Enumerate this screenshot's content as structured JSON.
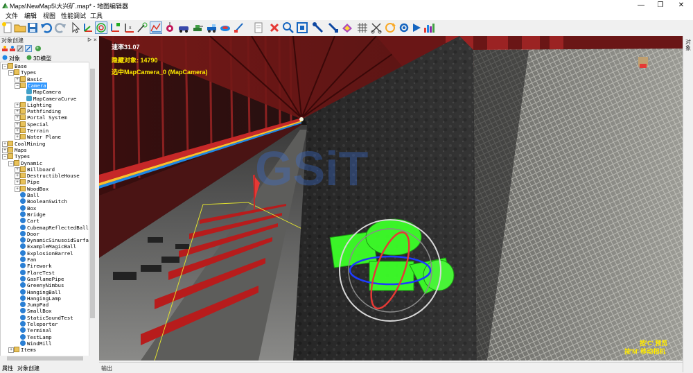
{
  "window": {
    "title": "Maps\\NewMap5\\大兴矿.map* - 地图编辑器",
    "controls": {
      "minimize": "—",
      "maximize": "❐",
      "close": "✕"
    }
  },
  "menu": {
    "items": [
      "文件",
      "编辑",
      "视图",
      "性能调试",
      "工具"
    ]
  },
  "toolbar": {
    "icons": [
      "new-file-icon",
      "open-folder-icon",
      "save-icon",
      "undo-icon",
      "redo-icon",
      "select-arrow-icon",
      "move-axis-icon",
      "rotate-icon",
      "scale-axis-icon",
      "axis-x-icon",
      "snap-icon",
      "terrain-icon",
      "place-object-icon",
      "car-icon",
      "tank-icon",
      "vehicle-icon",
      "water-icon",
      "sky-icon",
      "document-icon",
      "delete-icon",
      "zoom-icon",
      "frame-icon",
      "probe-icon",
      "measure-icon",
      "paint-icon",
      "grid-icon",
      "cut-icon",
      "refresh-icon",
      "settings-icon",
      "play-icon",
      "stats-icon"
    ]
  },
  "left_panel": {
    "title": "对象创建",
    "pin": "ᐅ",
    "close": "×",
    "tabs": {
      "objects": "对象",
      "model3d": "3D模型"
    },
    "tree": [
      {
        "label": "Base",
        "depth": 0,
        "type": "folder",
        "exp": "−"
      },
      {
        "label": "Types",
        "depth": 1,
        "type": "folder",
        "exp": "−"
      },
      {
        "label": "Basic",
        "depth": 2,
        "type": "folder",
        "exp": "+"
      },
      {
        "label": "Camera",
        "depth": 2,
        "type": "folder",
        "exp": "−",
        "selected": true
      },
      {
        "label": "MapCamera",
        "depth": 3,
        "type": "cam"
      },
      {
        "label": "MapCameraCurve",
        "depth": 3,
        "type": "cam"
      },
      {
        "label": "Lighting",
        "depth": 2,
        "type": "folder",
        "exp": "+"
      },
      {
        "label": "Pathfinding",
        "depth": 2,
        "type": "folder",
        "exp": "+"
      },
      {
        "label": "Portal System",
        "depth": 2,
        "type": "folder",
        "exp": "+"
      },
      {
        "label": "Special",
        "depth": 2,
        "type": "folder",
        "exp": "+"
      },
      {
        "label": "Terrain",
        "depth": 2,
        "type": "folder",
        "exp": "+"
      },
      {
        "label": "Water Plane",
        "depth": 2,
        "type": "folder",
        "exp": "+"
      },
      {
        "label": "CoalMining",
        "depth": 0,
        "type": "folder",
        "exp": "+"
      },
      {
        "label": "Maps",
        "depth": 0,
        "type": "folder",
        "exp": "+"
      },
      {
        "label": "Types",
        "depth": 0,
        "type": "folder",
        "exp": "−"
      },
      {
        "label": "Dynamic",
        "depth": 1,
        "type": "folder",
        "exp": "−"
      },
      {
        "label": "Billboard",
        "depth": 2,
        "type": "folder",
        "exp": "+"
      },
      {
        "label": "DestructibleHouse",
        "depth": 2,
        "type": "folder",
        "exp": "+"
      },
      {
        "label": "Pipe",
        "depth": 2,
        "type": "folder",
        "exp": "+"
      },
      {
        "label": "WoodBox",
        "depth": 2,
        "type": "folder",
        "exp": "+"
      },
      {
        "label": "Ball",
        "depth": 2,
        "type": "ball"
      },
      {
        "label": "BooleanSwitch",
        "depth": 2,
        "type": "ball"
      },
      {
        "label": "Box",
        "depth": 2,
        "type": "ball"
      },
      {
        "label": "Bridge",
        "depth": 2,
        "type": "ball"
      },
      {
        "label": "Cart",
        "depth": 2,
        "type": "ball"
      },
      {
        "label": "CubemapReflectedBall",
        "depth": 2,
        "type": "ball"
      },
      {
        "label": "Door",
        "depth": 2,
        "type": "ball"
      },
      {
        "label": "DynamicSinusoidSurfac",
        "depth": 2,
        "type": "ball"
      },
      {
        "label": "ExampleMagicBall",
        "depth": 2,
        "type": "ball"
      },
      {
        "label": "ExplosionBarrel",
        "depth": 2,
        "type": "ball"
      },
      {
        "label": "Fan",
        "depth": 2,
        "type": "ball"
      },
      {
        "label": "Firework",
        "depth": 2,
        "type": "ball"
      },
      {
        "label": "FlareTest",
        "depth": 2,
        "type": "ball"
      },
      {
        "label": "GasFlamePipe",
        "depth": 2,
        "type": "ball"
      },
      {
        "label": "GreenyNimbus",
        "depth": 2,
        "type": "ball"
      },
      {
        "label": "HangingBall",
        "depth": 2,
        "type": "ball"
      },
      {
        "label": "HangingLamp",
        "depth": 2,
        "type": "ball"
      },
      {
        "label": "JumpPad",
        "depth": 2,
        "type": "ball"
      },
      {
        "label": "SmallBox",
        "depth": 2,
        "type": "ball"
      },
      {
        "label": "StaticSoundTest",
        "depth": 2,
        "type": "ball"
      },
      {
        "label": "Teleporter",
        "depth": 2,
        "type": "ball"
      },
      {
        "label": "Terminal",
        "depth": 2,
        "type": "ball"
      },
      {
        "label": "TestLamp",
        "depth": 2,
        "type": "ball"
      },
      {
        "label": "WindMill",
        "depth": 2,
        "type": "ball"
      },
      {
        "label": "Items",
        "depth": 1,
        "type": "folder",
        "exp": "+"
      }
    ],
    "bottom_tabs": [
      "属性",
      "对象创建"
    ]
  },
  "viewport": {
    "hud_fps": "速率31.07",
    "hud_hidden": "隐藏对象: 14790",
    "hud_selected": "选中MapCamera_0 (MapCamera)",
    "hint_preview": "按'C' 预览",
    "hint_move": "按'M' 移动相机",
    "colors": {
      "hud_white": "#ffffff",
      "hud_yellow": "#ffea00",
      "gizmo_green": "#3cff28"
    }
  },
  "output": {
    "label": "输出"
  },
  "right_strip": {
    "label": "对象"
  }
}
